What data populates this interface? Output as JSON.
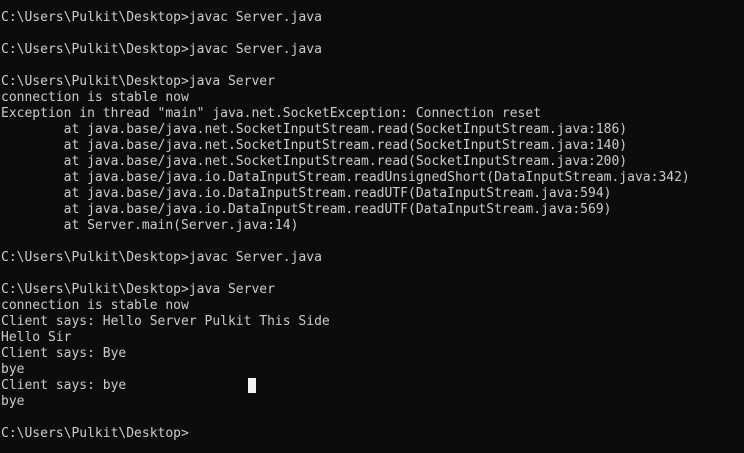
{
  "terminal": {
    "lines": [
      "C:\\Users\\Pulkit\\Desktop>javac Server.java",
      "",
      "C:\\Users\\Pulkit\\Desktop>javac Server.java",
      "",
      "C:\\Users\\Pulkit\\Desktop>java Server",
      "connection is stable now",
      "Exception in thread \"main\" java.net.SocketException: Connection reset",
      "        at java.base/java.net.SocketInputStream.read(SocketInputStream.java:186)",
      "        at java.base/java.net.SocketInputStream.read(SocketInputStream.java:140)",
      "        at java.base/java.net.SocketInputStream.read(SocketInputStream.java:200)",
      "        at java.base/java.io.DataInputStream.readUnsignedShort(DataInputStream.java:342)",
      "        at java.base/java.io.DataInputStream.readUTF(DataInputStream.java:594)",
      "        at java.base/java.io.DataInputStream.readUTF(DataInputStream.java:569)",
      "        at Server.main(Server.java:14)",
      "",
      "C:\\Users\\Pulkit\\Desktop>javac Server.java",
      "",
      "C:\\Users\\Pulkit\\Desktop>java Server",
      "connection is stable now",
      "Client says: Hello Server Pulkit This Side",
      "Hello Sir",
      "Client says: Bye",
      "bye",
      "Client says: bye",
      "bye",
      "",
      "C:\\Users\\Pulkit\\Desktop>"
    ],
    "colors": {
      "background": "#0c0c0c",
      "text": "#cccccc",
      "cursor": "#f2f2f2"
    }
  }
}
